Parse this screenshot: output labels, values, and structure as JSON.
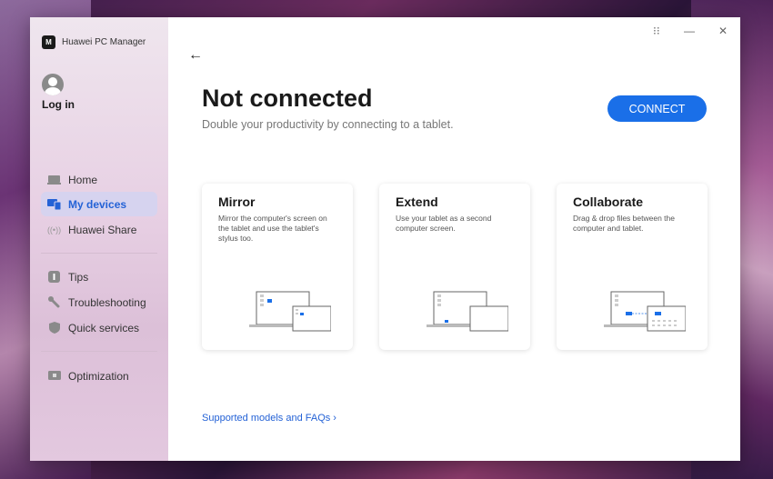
{
  "app": {
    "name": "Huawei PC Manager",
    "logo_text": "M"
  },
  "window_controls": {
    "more": "⁝⁝",
    "minimize": "—",
    "close": "✕"
  },
  "sidebar": {
    "login_label": "Log in",
    "items": [
      {
        "label": "Home",
        "icon": "laptop-icon"
      },
      {
        "label": "My devices",
        "icon": "devices-icon",
        "active": true
      },
      {
        "label": "Huawei Share",
        "icon": "share-wave-icon"
      },
      {
        "label": "Tips",
        "icon": "tips-icon"
      },
      {
        "label": "Troubleshooting",
        "icon": "wrench-icon"
      },
      {
        "label": "Quick services",
        "icon": "shield-icon"
      },
      {
        "label": "Optimization",
        "icon": "monitor-icon"
      }
    ]
  },
  "main": {
    "back_icon": "←",
    "title": "Not connected",
    "subtitle": "Double your productivity by connecting to a tablet.",
    "connect_label": "CONNECT",
    "cards": [
      {
        "title": "Mirror",
        "desc": "Mirror the computer's screen on the tablet and use the tablet's stylus too."
      },
      {
        "title": "Extend",
        "desc": "Use your tablet as a second computer screen."
      },
      {
        "title": "Collaborate",
        "desc": "Drag & drop files between the computer and tablet."
      }
    ],
    "faq_link": "Supported models and FAQs ›"
  },
  "colors": {
    "accent": "#1a6fe8",
    "active_bg": "#d6d3ef",
    "active_text": "#2462d6"
  }
}
